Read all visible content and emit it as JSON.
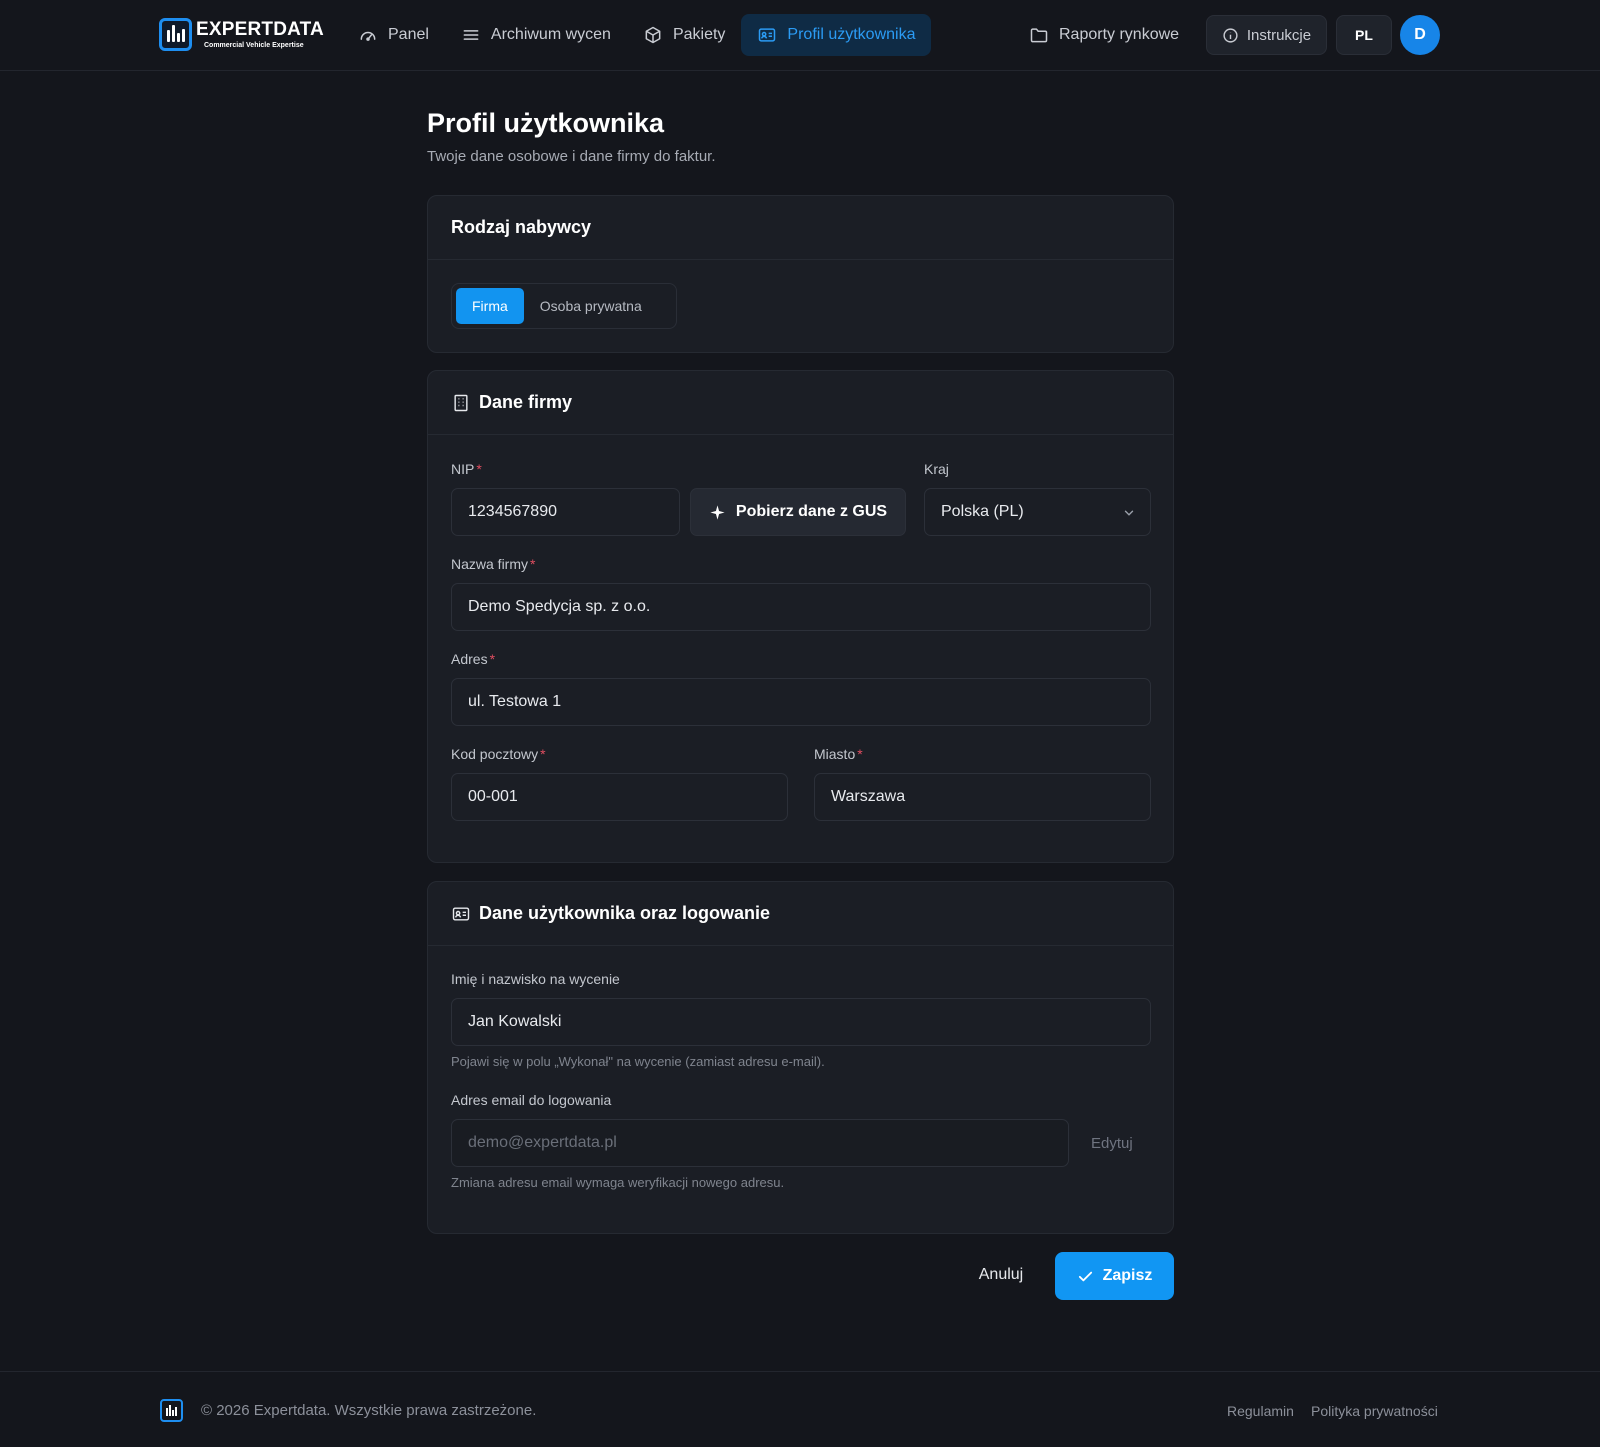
{
  "brand": {
    "name": "EXPERTDATA",
    "tagline": "Commercial Vehicle Expertise"
  },
  "nav": {
    "items": [
      {
        "label": "Panel",
        "icon": "gauge-icon"
      },
      {
        "label": "Archiwum wycen",
        "icon": "list-icon"
      },
      {
        "label": "Pakiety",
        "icon": "package-icon"
      },
      {
        "label": "Profil użytkownika",
        "icon": "id-card-icon",
        "active": true
      }
    ],
    "reports": {
      "label": "Raporty rynkowe",
      "icon": "folder-icon"
    },
    "instructions": {
      "label": "Instrukcje",
      "icon": "info-icon"
    },
    "language": "PL",
    "avatar_initial": "D"
  },
  "page": {
    "title": "Profil użytkownika",
    "subtitle": "Twoje dane osobowe i dane firmy do faktur."
  },
  "buyer_type": {
    "title": "Rodzaj nabywcy",
    "options": [
      "Firma",
      "Osoba prywatna"
    ],
    "selected": "Firma"
  },
  "company": {
    "title": "Dane firmy",
    "nip_label": "NIP",
    "nip_value": "1234567890",
    "gus_button": "Pobierz dane z GUS",
    "country_label": "Kraj",
    "country_value": "Polska (PL)",
    "name_label": "Nazwa firmy",
    "name_value": "Demo Spedycja sp. z o.o.",
    "address_label": "Adres",
    "address_value": "ul. Testowa 1",
    "postal_label": "Kod pocztowy",
    "postal_value": "00-001",
    "city_label": "Miasto",
    "city_value": "Warszawa",
    "required_mark": "*"
  },
  "user": {
    "title": "Dane użytkownika oraz logowanie",
    "fullname_label": "Imię i nazwisko na wycenie",
    "fullname_value": "Jan Kowalski",
    "fullname_hint": "Pojawi się w polu „Wykonał\" na wycenie (zamiast adresu e-mail).",
    "email_label": "Adres email do logowania",
    "email_value": "demo@expertdata.pl",
    "email_edit": "Edytuj",
    "email_hint": "Zmiana adresu email wymaga weryfikacji nowego adresu."
  },
  "actions": {
    "cancel": "Anuluj",
    "save": "Zapisz"
  },
  "footer": {
    "copyright": "© 2026 Expertdata. Wszystkie prawa zastrzeżone.",
    "links": [
      "Regulamin",
      "Polityka prywatności"
    ]
  },
  "colors": {
    "accent": "#1294f0",
    "background": "#14161c",
    "card": "#1b1e25",
    "required": "#e04d60"
  }
}
